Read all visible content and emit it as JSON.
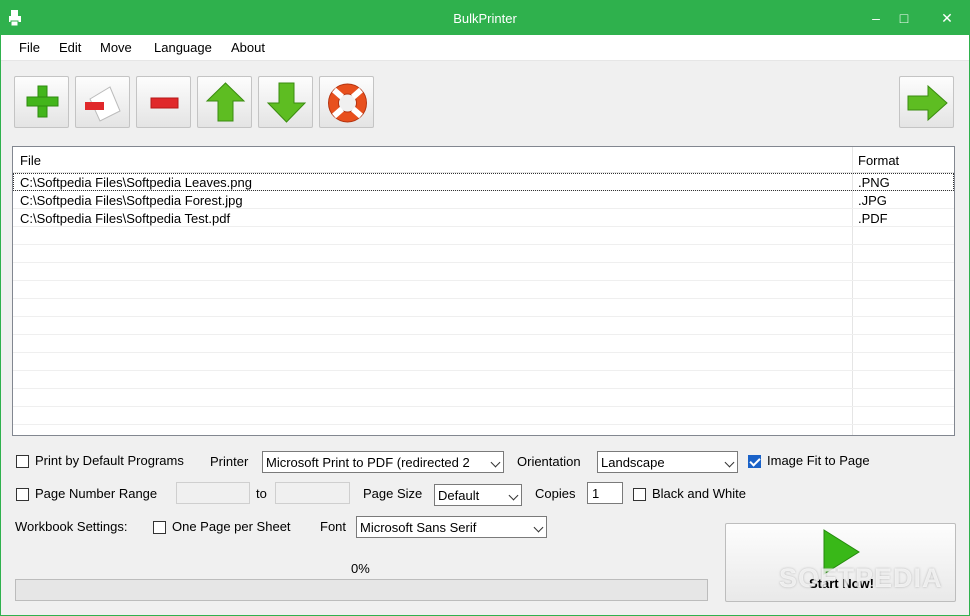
{
  "window": {
    "title": "BulkPrinter",
    "accent": "#2fb14d"
  },
  "menu": [
    "File",
    "Edit",
    "Move",
    "Language",
    "About"
  ],
  "toolbar": {
    "icons": [
      "add-icon",
      "remove-page-icon",
      "minus-icon",
      "arrow-up-icon",
      "arrow-down-icon",
      "lifebuoy-icon",
      "arrow-right-icon"
    ]
  },
  "file_list": {
    "columns": [
      "File",
      "Format"
    ],
    "rows": [
      {
        "file": "C:\\Softpedia Files\\Softpedia Leaves.png",
        "format": ".PNG"
      },
      {
        "file": "C:\\Softpedia Files\\Softpedia Forest.jpg",
        "format": ".JPG"
      },
      {
        "file": "C:\\Softpedia Files\\Softpedia Test.pdf",
        "format": ".PDF"
      }
    ]
  },
  "options": {
    "print_default_programs": {
      "label": "Print by Default Programs",
      "checked": false
    },
    "printer_label": "Printer",
    "printer_value": "Microsoft Print to PDF (redirected 2",
    "orientation_label": "Orientation",
    "orientation_value": "Landscape",
    "image_fit": {
      "label": "Image Fit to Page",
      "checked": true
    },
    "page_range": {
      "label": "Page Number Range",
      "checked": false
    },
    "range_to_label": "to",
    "page_size_label": "Page Size",
    "page_size_value": "Default",
    "copies_label": "Copies",
    "copies_value": "1",
    "black_white": {
      "label": "Black and White",
      "checked": false
    },
    "workbook_label": "Workbook Settings:",
    "one_page": {
      "label": "One Page per Sheet",
      "checked": false
    },
    "font_label": "Font",
    "font_value": "Microsoft Sans Serif"
  },
  "progress": {
    "label": "0%",
    "value": 0
  },
  "start_button": {
    "label": "Start Now!"
  },
  "watermark": "SOFTPEDIA"
}
